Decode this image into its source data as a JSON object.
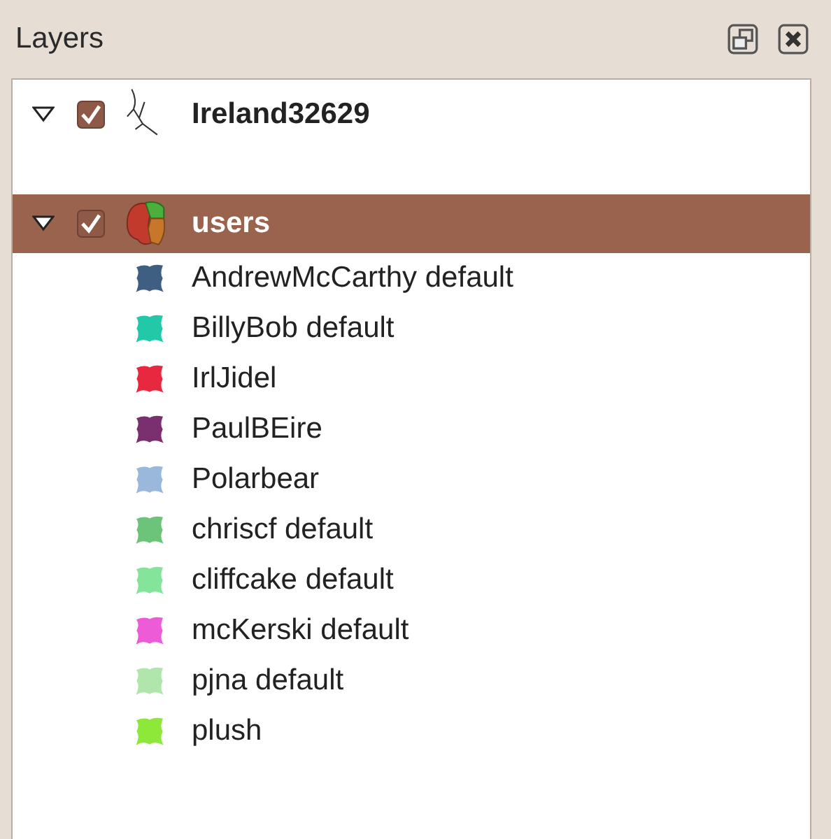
{
  "panel": {
    "title": "Layers"
  },
  "layers": [
    {
      "name": "Ireland32629",
      "kind": "line",
      "expanded": true,
      "checked": true,
      "selected": false
    },
    {
      "name": "users",
      "kind": "polygon",
      "expanded": true,
      "checked": true,
      "selected": true,
      "legend": [
        {
          "label": "AndrewMcCarthy default",
          "color": "#3f5f82"
        },
        {
          "label": "BillyBob default",
          "color": "#22c9a8"
        },
        {
          "label": "IrlJidel",
          "color": "#e8283f"
        },
        {
          "label": "PaulBEire",
          "color": "#7a2f6e"
        },
        {
          "label": "Polarbear",
          "color": "#9ab8db"
        },
        {
          "label": "chriscf default",
          "color": "#6cc47a"
        },
        {
          "label": "cliffcake default",
          "color": "#84e59a"
        },
        {
          "label": "mcKerski default",
          "color": "#ee5bd6"
        },
        {
          "label": "pjna default",
          "color": "#b0e6ab"
        },
        {
          "label": "plush",
          "color": "#8ee83a"
        }
      ]
    }
  ]
}
